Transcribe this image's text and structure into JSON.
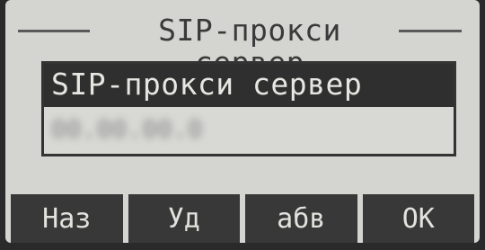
{
  "screen": {
    "title": "SIP-прокси сервер"
  },
  "field": {
    "label": "SIP-прокси сервер",
    "value": "00.00.00.0"
  },
  "softkeys": [
    {
      "label": "Наз"
    },
    {
      "label": "Уд"
    },
    {
      "label": "абв"
    },
    {
      "label": "ОК"
    }
  ]
}
